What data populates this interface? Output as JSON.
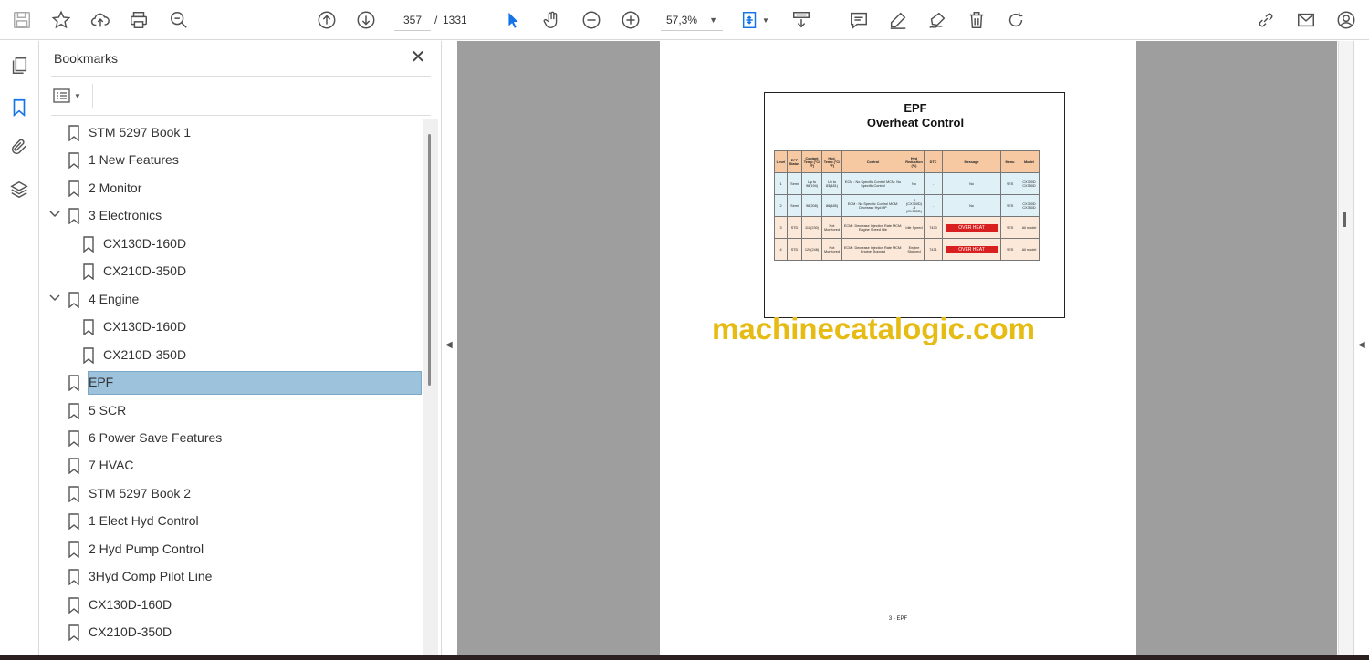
{
  "toolbar": {
    "page_current": "357",
    "page_separator": "/",
    "page_total": "1331",
    "zoom": "57,3%"
  },
  "bookmarks_panel": {
    "title": "Bookmarks",
    "items": [
      {
        "label": "STM 5297 Book 1",
        "level": 0,
        "expandable": false,
        "selected": false
      },
      {
        "label": "1 New Features",
        "level": 0,
        "expandable": false,
        "selected": false
      },
      {
        "label": "2 Monitor",
        "level": 0,
        "expandable": false,
        "selected": false
      },
      {
        "label": "3 Electronics",
        "level": 0,
        "expandable": true,
        "selected": false
      },
      {
        "label": "CX130D-160D",
        "level": 1,
        "expandable": false,
        "selected": false
      },
      {
        "label": "CX210D-350D",
        "level": 1,
        "expandable": false,
        "selected": false
      },
      {
        "label": "4 Engine",
        "level": 0,
        "expandable": true,
        "selected": false
      },
      {
        "label": "CX130D-160D",
        "level": 1,
        "expandable": false,
        "selected": false
      },
      {
        "label": "CX210D-350D",
        "level": 1,
        "expandable": false,
        "selected": false
      },
      {
        "label": "EPF",
        "level": 0,
        "expandable": false,
        "selected": true
      },
      {
        "label": "5 SCR",
        "level": 0,
        "expandable": false,
        "selected": false
      },
      {
        "label": "6 Power Save Features",
        "level": 0,
        "expandable": false,
        "selected": false
      },
      {
        "label": "7 HVAC",
        "level": 0,
        "expandable": false,
        "selected": false
      },
      {
        "label": "STM 5297 Book 2",
        "level": 0,
        "expandable": false,
        "selected": false
      },
      {
        "label": "1 Elect Hyd Control",
        "level": 0,
        "expandable": false,
        "selected": false
      },
      {
        "label": "2 Hyd Pump Control",
        "level": 0,
        "expandable": false,
        "selected": false
      },
      {
        "label": "3Hyd Comp Pilot Line",
        "level": 0,
        "expandable": false,
        "selected": false
      },
      {
        "label": "CX130D-160D",
        "level": 0,
        "expandable": false,
        "selected": false
      },
      {
        "label": "CX210D-350D",
        "level": 0,
        "expandable": false,
        "selected": false
      }
    ]
  },
  "document": {
    "title_line1": "EPF",
    "title_line2": "Overheat Control",
    "table_headers": [
      "Level",
      "EPF Status",
      "Coolant Temp (°C/°F)",
      "Hyd. Temp (°C/°F)",
      "Control",
      "Hyd Reduction (%)",
      "DTC",
      "Message",
      "Menu",
      "Model"
    ],
    "rows": [
      {
        "level": "1",
        "status": "Semi",
        "coolant": "Up to 98(194)",
        "hyd": "Up to 83(181)",
        "control": "ECM : No Specific Control\nMCM: No Specific Control",
        "reduction": "No",
        "dtc": "-",
        "message": "No",
        "menu": "YES",
        "model": "CX300D\nCX350D",
        "style": "blue",
        "overheat": false
      },
      {
        "level": "2",
        "status": "Semi",
        "coolant": "98(208)",
        "hyd": "86(185)",
        "control": "ECM : No Specific Control\nMCM: Decrease Hyd HP",
        "reduction": "-8 (CX300D)\n-8 (CX350D)",
        "dtc": "-",
        "message": "No",
        "menu": "YES",
        "model": "CX300D\nCX350D",
        "style": "blue",
        "overheat": false
      },
      {
        "level": "3",
        "status": "STD",
        "coolant": "110(230)",
        "hyd": "Not Monitored",
        "control": "ECM : Decrease Injection Rate\nMCM: Engine Speed Idle",
        "reduction": "Idle Speed",
        "dtc": "7430",
        "message": "OVER HEAT",
        "menu": "YES",
        "model": "All model",
        "style": "peach",
        "overheat": true
      },
      {
        "level": "4",
        "status": "STD",
        "coolant": "120(248)",
        "hyd": "Not Monitored",
        "control": "ECM : Decrease Injection Rate\nMCM: Engine Stopped",
        "reduction": "Engine Stopped",
        "dtc": "7431",
        "message": "OVER HEAT",
        "menu": "YES",
        "model": "All model",
        "style": "peach",
        "overheat": true
      }
    ],
    "footer": "3 - EPF",
    "watermark": "machinecatalogic.com"
  }
}
